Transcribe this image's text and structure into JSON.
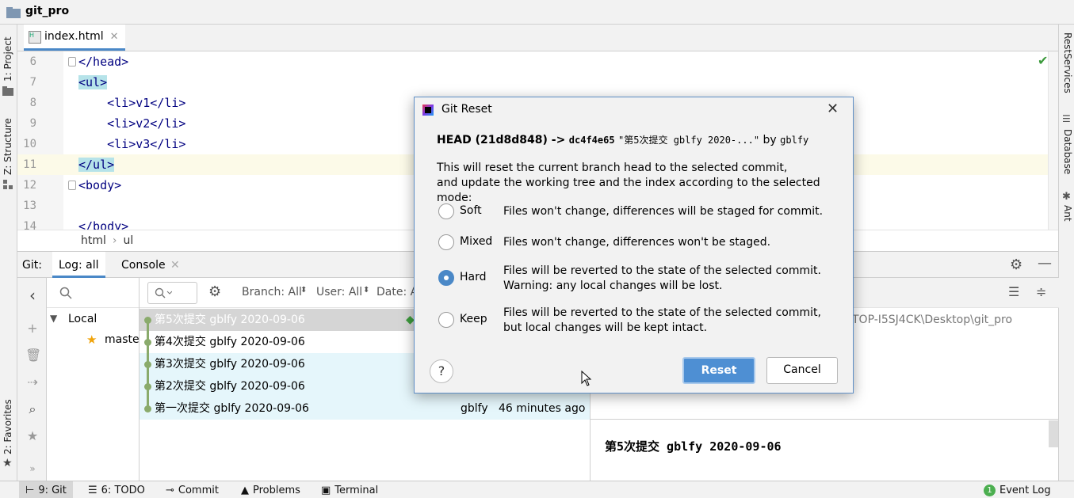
{
  "window": {
    "project_name": "git_pro"
  },
  "left_strip": {
    "project": "1: Project",
    "structure": "Z: Structure",
    "favorites": "2: Favorites"
  },
  "right_strip": {
    "rest": "RestServices",
    "database": "Database",
    "ant": "Ant"
  },
  "editor": {
    "tab_label": "index.html",
    "lines": [
      {
        "num": "6",
        "code": "</head>"
      },
      {
        "num": "7",
        "code": "<ul>"
      },
      {
        "num": "8",
        "code": "    <li>v1</li>"
      },
      {
        "num": "9",
        "code": "    <li>v2</li>"
      },
      {
        "num": "10",
        "code": "    <li>v3</li>"
      },
      {
        "num": "11",
        "code": "</ul>"
      },
      {
        "num": "12",
        "code": "<body>"
      },
      {
        "num": "13",
        "code": ""
      },
      {
        "num": "14",
        "code": "</body>"
      }
    ],
    "breadcrumb": [
      "html",
      "ul"
    ]
  },
  "git_panel": {
    "label": "Git:",
    "tabs": [
      "Log: all",
      "Console"
    ],
    "branches": {
      "local": "Local",
      "master": "master"
    },
    "toolbar": {
      "branch": "Branch: All",
      "user": "User: All",
      "date": "Date: A"
    },
    "commits": [
      {
        "msg": "第5次提交 gblfy 2020-09-06",
        "author": "",
        "time": ""
      },
      {
        "msg": "第4次提交 gblfy 2020-09-06",
        "author": "",
        "time": ""
      },
      {
        "msg": "第3次提交 gblfy 2020-09-06",
        "author": "",
        "time": ""
      },
      {
        "msg": "第2次提交 gblfy 2020-09-06",
        "author": "",
        "time": ""
      },
      {
        "msg": "第一次提交 gblfy 2020-09-06",
        "author": "gblfy",
        "time": "46 minutes ago"
      }
    ],
    "details": {
      "path": "TOP-I5SJ4CK\\Desktop\\git_pro",
      "commit_title": "第5次提交 gblfy 2020-09-06"
    }
  },
  "statusbar": {
    "git": "9: Git",
    "todo": "6: TODO",
    "commit": "Commit",
    "problems": "Problems",
    "terminal": "Terminal",
    "event_log": "Event Log",
    "event_count": "1"
  },
  "dialog": {
    "title": "Git Reset",
    "head_prefix": "HEAD (21d8d848) ->",
    "target_hash": "dc4f4e65",
    "target_msg": "\"第5次提交 gblfy 2020-...\"",
    "by": "by",
    "author": "gblfy",
    "desc_line1": "This will reset the current branch head to the selected commit,",
    "desc_line2": "and update the working tree and the index according to the selected mode:",
    "options": [
      {
        "name": "Soft",
        "line1": "Files won't change, differences will be staged for commit.",
        "line2": "",
        "checked": false
      },
      {
        "name": "Mixed",
        "line1": "Files won't change, differences won't be staged.",
        "line2": "",
        "checked": false
      },
      {
        "name": "Hard",
        "line1": "Files will be reverted to the state of the selected commit.",
        "line2": "Warning: any local changes will be lost.",
        "checked": true
      },
      {
        "name": "Keep",
        "line1": "Files will be reverted to the state of the selected commit,",
        "line2": "but local changes will be kept intact.",
        "checked": false
      }
    ],
    "help": "?",
    "reset_label": "Reset",
    "cancel_label": "Cancel"
  }
}
